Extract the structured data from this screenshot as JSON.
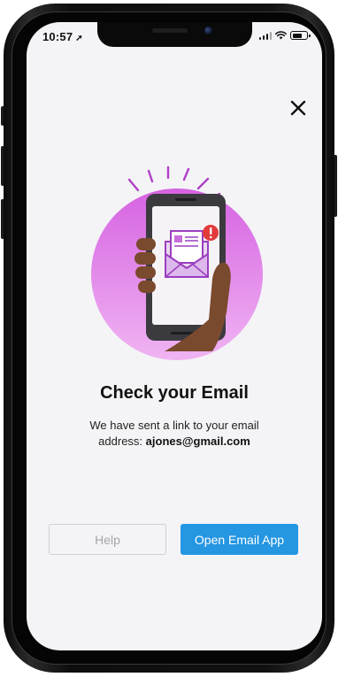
{
  "status_bar": {
    "time": "10:57",
    "battery_level": 0.75
  },
  "icons": {
    "close": "close-icon",
    "location": "location-arrow-icon",
    "signal": "cellular-signal-icon",
    "wifi": "wifi-icon",
    "battery": "battery-icon",
    "illustration": "phone-email-illustration"
  },
  "content": {
    "title": "Check your Email",
    "message_line1": "We have sent a link to your email",
    "message_prefix": "address: ",
    "email": "ajones@gmail.com"
  },
  "buttons": {
    "help_label": "Help",
    "open_email_label": "Open Email App"
  },
  "colors": {
    "primary": "#2496e2",
    "illustration_circle": "#d56fe0",
    "notification_badge": "#e23b3b",
    "envelope": "#9b3fbf"
  }
}
